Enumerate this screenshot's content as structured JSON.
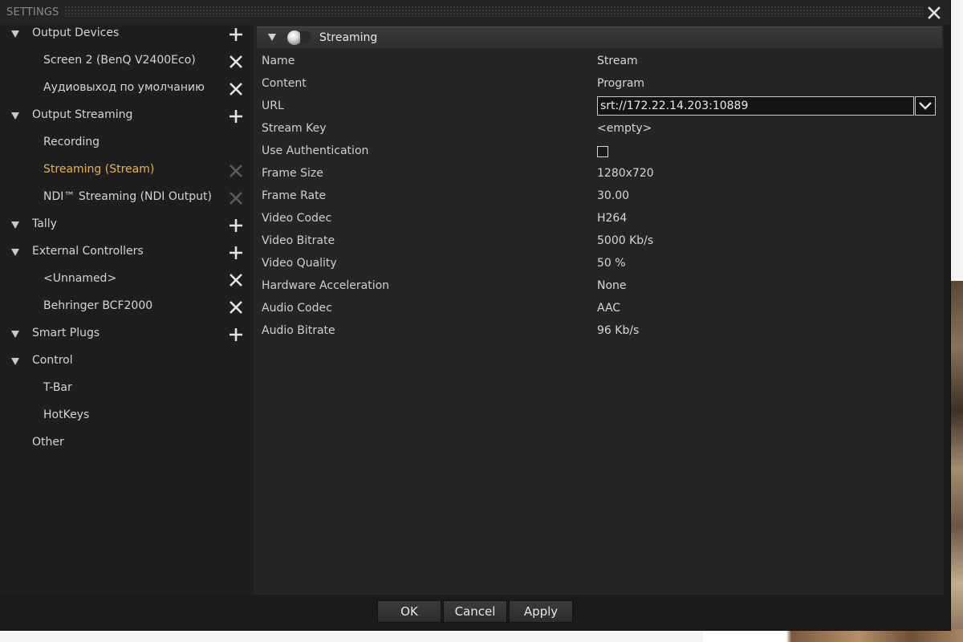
{
  "window": {
    "title": "SETTINGS",
    "close_icon": "close-icon"
  },
  "sidebar": {
    "groups": [
      {
        "label": "Output Devices",
        "action_icon": "plus-icon",
        "children": [
          {
            "label": "Screen 2 (BenQ V2400Eco)",
            "action_icon": "x-icon",
            "enabled": true
          },
          {
            "label": "Аудиовыход по умолчанию",
            "action_icon": "x-icon",
            "enabled": true
          }
        ]
      },
      {
        "label": "Output Streaming",
        "action_icon": "plus-icon",
        "children": [
          {
            "label": "Recording"
          },
          {
            "label": "Streaming (Stream)",
            "action_icon": "x-icon",
            "enabled": false,
            "selected": true
          },
          {
            "label": "NDI™ Streaming (NDI Output)",
            "action_icon": "x-icon",
            "enabled": false
          }
        ]
      },
      {
        "label": "Tally",
        "action_icon": "plus-icon",
        "children": []
      },
      {
        "label": "External Controllers",
        "action_icon": "plus-icon",
        "children": [
          {
            "label": "<Unnamed>",
            "action_icon": "x-icon",
            "enabled": true
          },
          {
            "label": "Behringer BCF2000",
            "action_icon": "x-icon",
            "enabled": true
          }
        ]
      },
      {
        "label": "Smart Plugs",
        "action_icon": "plus-icon",
        "children": []
      },
      {
        "label": "Control",
        "children": [
          {
            "label": "T-Bar"
          },
          {
            "label": "HotKeys"
          }
        ]
      }
    ],
    "other_label": "Other"
  },
  "section": {
    "title": "Streaming",
    "caret_icon": "caret-down-icon",
    "status_icon": "disc-icon"
  },
  "properties": [
    {
      "name": "Name",
      "value": "Stream"
    },
    {
      "name": "Content",
      "value": "Program"
    },
    {
      "name": "URL",
      "value": "srt://172.22.14.203:10889",
      "type": "input"
    },
    {
      "name": "Stream Key",
      "value": "<empty>"
    },
    {
      "name": "Use Authentication",
      "type": "checkbox",
      "checked": false
    },
    {
      "name": "Frame Size",
      "value": "1280x720"
    },
    {
      "name": "Frame Rate",
      "value": "30.00"
    },
    {
      "name": "Video Codec",
      "value": "H264"
    },
    {
      "name": "Video Bitrate",
      "value": "5000 Kb/s"
    },
    {
      "name": "Video Quality",
      "value": "50 %"
    },
    {
      "name": "Hardware Acceleration",
      "value": "None"
    },
    {
      "name": "Audio Codec",
      "value": "AAC"
    },
    {
      "name": "Audio Bitrate",
      "value": "96 Kb/s"
    }
  ],
  "buttons": {
    "ok": "OK",
    "cancel": "Cancel",
    "apply": "Apply"
  },
  "colors": {
    "selected_item": "#e6b44c",
    "window_bg": "#1b1b1b",
    "panel_bg": "#252525"
  }
}
